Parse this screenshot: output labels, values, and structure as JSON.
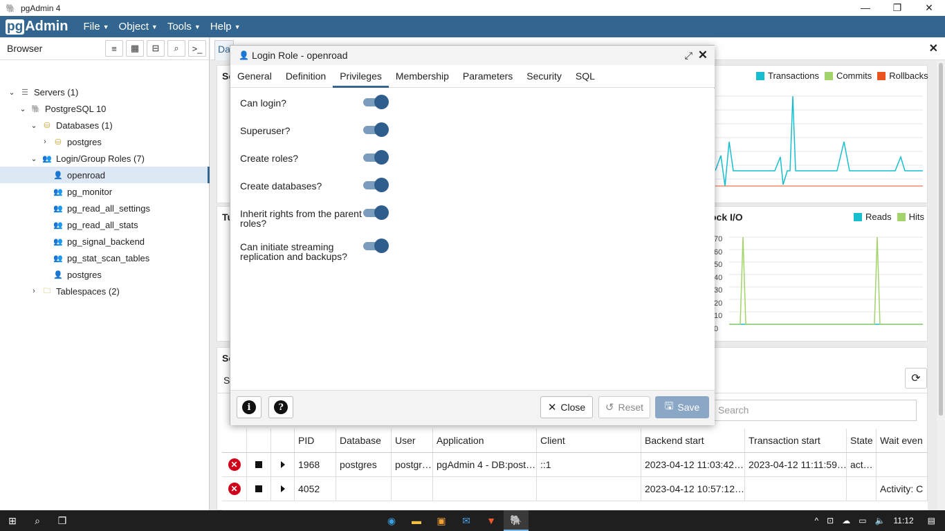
{
  "window": {
    "title": "pgAdmin 4",
    "minimize": "—",
    "restore": "❐",
    "close": "✕"
  },
  "menubar": {
    "logo_pg": "pg",
    "logo_admin": "Admin",
    "items": [
      "File",
      "Object",
      "Tools",
      "Help"
    ]
  },
  "browser": {
    "label": "Browser",
    "tree": [
      {
        "label": "Servers (1)",
        "icon": "server-icon",
        "arrow": "▾",
        "indent": 0
      },
      {
        "label": "PostgreSQL 10",
        "icon": "postgres-icon",
        "arrow": "▾",
        "indent": 1
      },
      {
        "label": "Databases (1)",
        "icon": "database-icon",
        "arrow": "▾",
        "indent": 2
      },
      {
        "label": "postgres",
        "icon": "database-icon",
        "arrow": "›",
        "indent": 3
      },
      {
        "label": "Login/Group Roles (7)",
        "icon": "roles-icon",
        "arrow": "▾",
        "indent": 2
      },
      {
        "label": "openroad",
        "icon": "role-icon",
        "arrow": "",
        "indent": 3,
        "selected": true
      },
      {
        "label": "pg_monitor",
        "icon": "group-role-icon",
        "arrow": "",
        "indent": 3
      },
      {
        "label": "pg_read_all_settings",
        "icon": "group-role-icon",
        "arrow": "",
        "indent": 3
      },
      {
        "label": "pg_read_all_stats",
        "icon": "group-role-icon",
        "arrow": "",
        "indent": 3
      },
      {
        "label": "pg_signal_backend",
        "icon": "group-role-icon",
        "arrow": "",
        "indent": 3
      },
      {
        "label": "pg_stat_scan_tables",
        "icon": "group-role-icon",
        "arrow": "",
        "indent": 3
      },
      {
        "label": "postgres",
        "icon": "role-icon",
        "arrow": "",
        "indent": 3
      },
      {
        "label": "Tablespaces (2)",
        "icon": "tablespace-icon",
        "arrow": "›",
        "indent": 2
      }
    ]
  },
  "main": {
    "tab_label": "Da",
    "panel1_prefix": "Se",
    "panel2_prefix": "Tu",
    "panel3_prefix": "Se",
    "subtab_prefix": "S",
    "legend_top": [
      {
        "name": "Transactions",
        "color": "#17becf"
      },
      {
        "name": "Commits",
        "color": "#a3d36b"
      },
      {
        "name": "Rollbacks",
        "color": "#e8531f"
      }
    ],
    "block_io_title": "ock I/O",
    "legend_io": [
      {
        "name": "Reads",
        "color": "#17becf"
      },
      {
        "name": "Hits",
        "color": "#a3d36b"
      }
    ],
    "io_ticks": [
      "70",
      "60",
      "50",
      "40",
      "30",
      "20",
      "10",
      "0"
    ],
    "search_placeholder": "Search"
  },
  "activity": {
    "headers": [
      "",
      "",
      "",
      "PID",
      "Database",
      "User",
      "Application",
      "Client",
      "Backend start",
      "Transaction start",
      "State",
      "Wait even"
    ],
    "rows": [
      [
        "1968",
        "postgres",
        "postgr…",
        "pgAdmin 4 - DB:post…",
        "::1",
        "2023-04-12 11:03:42…",
        "2023-04-12 11:11:59…",
        "act…",
        ""
      ],
      [
        "4052",
        "",
        "",
        "",
        "",
        "2023-04-12 10:57:12…",
        "",
        "",
        "Activity: C"
      ]
    ]
  },
  "dialog": {
    "title": "Login Role - openroad",
    "tabs": [
      "General",
      "Definition",
      "Privileges",
      "Membership",
      "Parameters",
      "Security",
      "SQL"
    ],
    "active_tab": "Privileges",
    "privileges": [
      {
        "label": "Can login?",
        "value": true
      },
      {
        "label": "Superuser?",
        "value": true
      },
      {
        "label": "Create roles?",
        "value": true
      },
      {
        "label": "Create databases?",
        "value": true
      },
      {
        "label": "Inherit rights from the parent roles?",
        "value": true
      },
      {
        "label": "Can initiate streaming replication and backups?",
        "value": true
      }
    ],
    "buttons": {
      "info": "i",
      "help": "?",
      "close": "Close",
      "reset": "Reset",
      "save": "Save"
    }
  },
  "taskbar": {
    "time": "11:12"
  },
  "colors": {
    "brand": "#326690",
    "toggle_on": "#2f5d8c",
    "save_disabled": "#8aa8c6"
  }
}
